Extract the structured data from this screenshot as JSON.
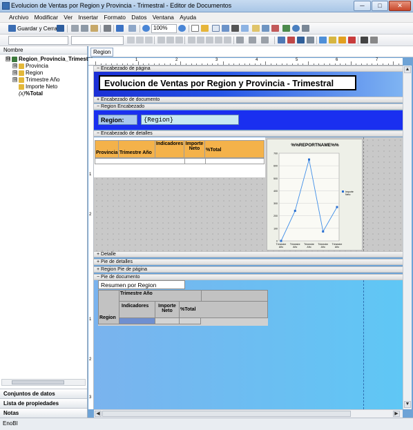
{
  "window": {
    "title": "Evolucion de Ventas por Region y Provincia - Trimestral - Editor de Documentos",
    "min_glyph": "─",
    "max_glyph": "□",
    "close_glyph": "✕"
  },
  "menu": [
    "Archivo",
    "Modificar",
    "Ver",
    "Insertar",
    "Formato",
    "Datos",
    "Ventana",
    "Ayuda"
  ],
  "toolbar": {
    "save_close_label": "Guardar y Cerrar",
    "zoom_value": "100%"
  },
  "left_panel": {
    "header": "Nombre",
    "tree": [
      {
        "label": "Region_Provincia_Trimestre",
        "bold": true,
        "level": 0,
        "expander": "⊟"
      },
      {
        "label": "Provincia",
        "level": 1,
        "expander": "⊞"
      },
      {
        "label": "Region",
        "level": 1,
        "expander": "⊞"
      },
      {
        "label": "Trimestre Año",
        "level": 1,
        "expander": "⊞"
      },
      {
        "label": "Importe Neto",
        "level": 1,
        "expander": ""
      },
      {
        "label": "%Total",
        "level": 1,
        "expander": "",
        "prefix": "(x)"
      }
    ],
    "bottom_buttons": [
      "Conjuntos de datos",
      "Lista de propiedades",
      "Notas"
    ]
  },
  "doc_tab": "Region",
  "ruler_numbers": [
    "1",
    "2",
    "3",
    "4",
    "5",
    "6",
    "7"
  ],
  "vruler_numbers": [
    "1",
    "2",
    "1",
    "2",
    "3"
  ],
  "bands": {
    "page_header": "− Encabezado de página",
    "doc_header": "+ Encabezado de documento",
    "region_header": "− Region Encabezado",
    "details_header": "− Encabezado de detalles",
    "detail": "+ Detalle",
    "details_footer": "+ Pie de detalles",
    "region_footer": "+ Region Pie de página",
    "doc_footer": "− Pie de documento"
  },
  "report": {
    "title": "Evolucion de Ventas por Region y Provincia - Trimestral",
    "region_label": "Region:",
    "region_field": "{Region}"
  },
  "details_table": {
    "headers": [
      "Provincia",
      "Trimestre Año",
      "Indicadores",
      "Importe Neto",
      "%Total"
    ]
  },
  "chart_data": {
    "type": "line",
    "title": "%%REPORTNAME%%",
    "categories": [
      "Trimestre Año",
      "Trimestre Año",
      "Trimestre Año",
      "Trimestre Año",
      "Trimestre Año"
    ],
    "series": [
      {
        "name": "Importe Neto",
        "values": [
          0,
          240,
          650,
          75,
          270
        ]
      }
    ],
    "ylim": [
      0,
      700
    ],
    "yticks": [
      "0",
      "100",
      "200",
      "300",
      "400",
      "500",
      "600",
      "700"
    ],
    "color": "#3f8ee8",
    "legend": "right",
    "grid": true
  },
  "summary": {
    "title": "Resumen por Region",
    "headers": {
      "trimestre": "Trimestre Año",
      "indicadores": "Indicadores",
      "importe": "Importe Neto",
      "total": "%Total",
      "region": "Region"
    }
  },
  "status": "EnoBI"
}
